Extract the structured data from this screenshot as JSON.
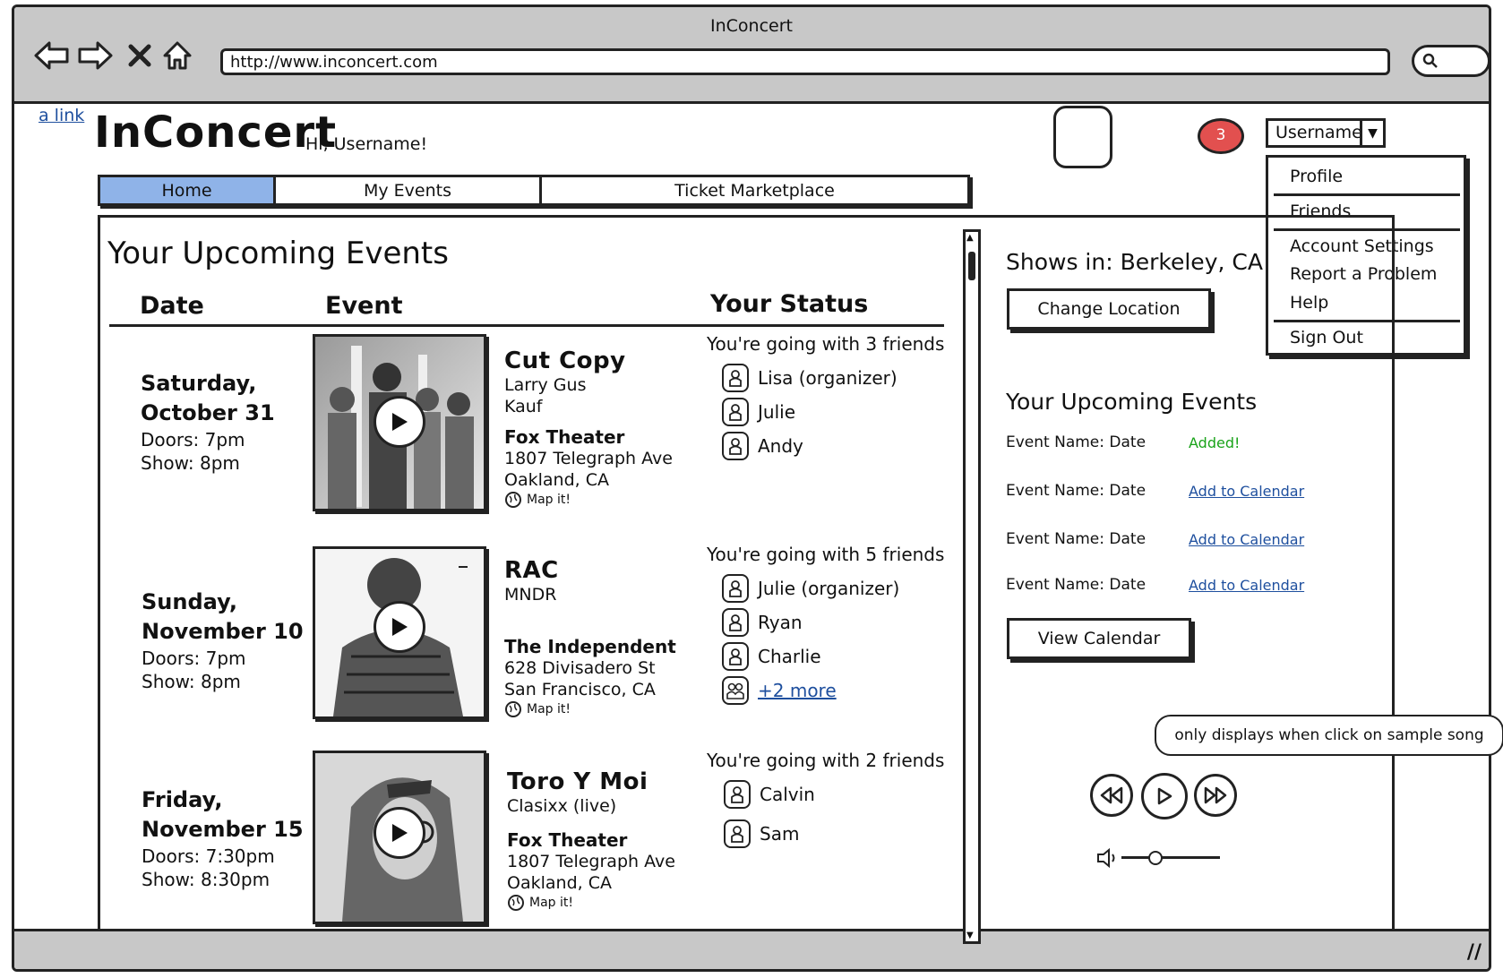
{
  "window": {
    "title": "InConcert",
    "url": "http://www.inconcert.com"
  },
  "header": {
    "link_text": "a link",
    "brand": "InConcert",
    "greeting": "Hi, Username!",
    "notification_count": "3",
    "user_dropdown": "Username"
  },
  "user_menu": {
    "items": [
      "Profile",
      "Friends",
      "Account Settings",
      "Report a Problem",
      "Help",
      "Sign Out"
    ]
  },
  "tabs": [
    {
      "label": "Home",
      "active": true
    },
    {
      "label": "My Events",
      "active": false
    },
    {
      "label": "Ticket Marketplace",
      "active": false
    }
  ],
  "main": {
    "title": "Your Upcoming Events",
    "columns": [
      "Date",
      "Event",
      "Your Status"
    ],
    "events": [
      {
        "day": "Saturday,",
        "date": "October 31",
        "doors": "Doors: 7pm",
        "show": "Show: 8pm",
        "band": "Cut Copy",
        "support1": "Larry Gus",
        "support2": "Kauf",
        "venue": "Fox Theater",
        "addr1": "1807 Telegraph Ave",
        "addr2": "Oakland, CA",
        "map": "Map it!",
        "going": "You're going with 3 friends",
        "friends": [
          "Lisa (organizer)",
          "Julie",
          "Andy"
        ]
      },
      {
        "day": "Sunday,",
        "date": "November 10",
        "doors": "Doors: 7pm",
        "show": "Show: 8pm",
        "band": "RAC",
        "support1": "MNDR",
        "support2": "",
        "venue": "The Independent",
        "addr1": "628 Divisadero St",
        "addr2": "San Francisco, CA",
        "map": "Map it!",
        "going": "You're going with 5 friends",
        "friends": [
          "Julie (organizer)",
          "Ryan",
          "Charlie"
        ],
        "more": "+2 more"
      },
      {
        "day": "Friday,",
        "date": "November 15",
        "doors": "Doors: 7:30pm",
        "show": "Show: 8:30pm",
        "band": "Toro Y Moi",
        "support1": "Clasixx (live)",
        "support2": "",
        "venue": "Fox Theater",
        "addr1": "1807 Telegraph Ave",
        "addr2": "Oakland, CA",
        "map": "Map it!",
        "going": "You're going with 2 friends",
        "friends": [
          "Calvin",
          "Sam"
        ]
      }
    ]
  },
  "sidebar": {
    "shows_in": "Shows in: Berkeley, CA",
    "change_location": "Change Location",
    "upcoming_title": "Your Upcoming Events",
    "events": [
      {
        "name": "Event Name: Date",
        "action": "Added!"
      },
      {
        "name": "Event Name: Date",
        "action": "Add to Calendar"
      },
      {
        "name": "Event Name: Date",
        "action": "Add to Calendar"
      },
      {
        "name": "Event Name: Date",
        "action": "Add to Calendar"
      }
    ],
    "view_calendar": "View Calendar",
    "player_note": "only displays when click on sample song"
  },
  "colors": {
    "active_tab": "#8fb3e8",
    "notification": "#e2504f",
    "added": "#1aa31a",
    "link": "#1e4f9e"
  }
}
